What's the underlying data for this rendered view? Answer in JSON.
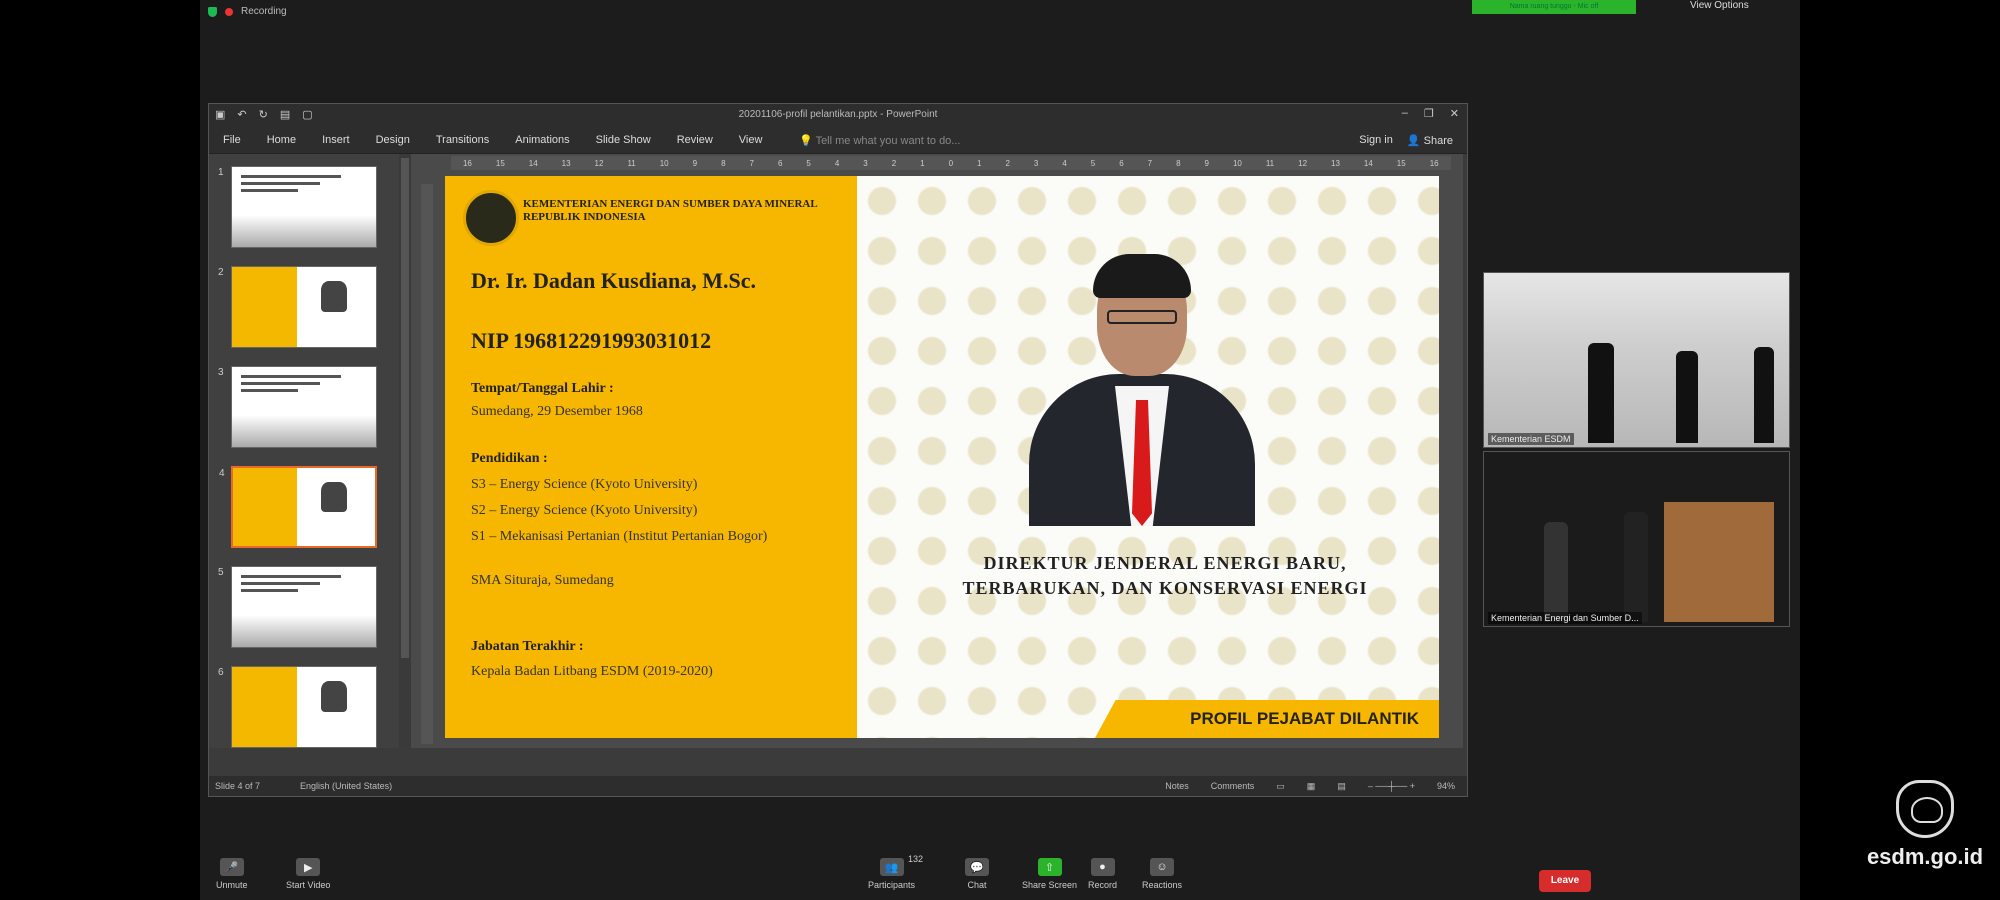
{
  "zoom": {
    "recording_label": "Recording",
    "banner_text": "Nama ruang tunggu - Mic off",
    "view_options": "View Options",
    "toolbar": {
      "unmute": "Unmute",
      "start_video": "Start Video",
      "participants": "Participants",
      "participants_count": "132",
      "chat": "Chat",
      "share_screen": "Share Screen",
      "record": "Record",
      "reactions": "Reactions",
      "leave": "Leave"
    },
    "videos": [
      {
        "name": "Kementerian ESDM"
      },
      {
        "name": "Kementerian Energi dan Sumber D..."
      }
    ]
  },
  "powerpoint": {
    "doc_title": "20201106-profil pelantikan.pptx - PowerPoint",
    "ribbon_tabs": [
      "File",
      "Home",
      "Insert",
      "Design",
      "Transitions",
      "Animations",
      "Slide Show",
      "Review",
      "View"
    ],
    "tell_me": "Tell me what you want to do...",
    "sign_in": "Sign in",
    "share": "Share",
    "thumbnails": [
      {
        "num": "1",
        "type": "white"
      },
      {
        "num": "2",
        "type": "yellow"
      },
      {
        "num": "3",
        "type": "white"
      },
      {
        "num": "4",
        "type": "yellow"
      },
      {
        "num": "5",
        "type": "white"
      },
      {
        "num": "6",
        "type": "yellow"
      }
    ],
    "ruler_ticks": [
      "16",
      "15",
      "14",
      "13",
      "12",
      "11",
      "10",
      "9",
      "8",
      "7",
      "6",
      "5",
      "4",
      "3",
      "2",
      "1",
      "0",
      "1",
      "2",
      "3",
      "4",
      "5",
      "6",
      "7",
      "8",
      "9",
      "10",
      "11",
      "12",
      "13",
      "14",
      "15",
      "16"
    ],
    "status": {
      "slide": "Slide 4 of 7",
      "language": "English (United States)",
      "notes": "Notes",
      "comments": "Comments",
      "zoom": "94%"
    }
  },
  "slide": {
    "ministry_line1": "KEMENTERIAN ENERGI DAN SUMBER DAYA MINERAL",
    "ministry_line2": "REPUBLIK INDONESIA",
    "name": "Dr. Ir. Dadan Kusdiana, M.Sc.",
    "nip": "NIP 196812291993031012",
    "birth_label": "Tempat/Tanggal Lahir :",
    "birth_value": "Sumedang, 29 Desember 1968",
    "education_label": "Pendidikan :",
    "education": [
      "S3 – Energy Science (Kyoto University)",
      "S2 – Energy Science (Kyoto University)",
      "S1 – Mekanisasi Pertanian (Institut Pertanian Bogor)",
      "SMA Situraja, Sumedang"
    ],
    "position_label": "Jabatan Terakhir :",
    "position_value": "Kepala Badan Litbang ESDM (2019-2020)",
    "role_title_line1": "DIREKTUR JENDERAL ENERGI BARU,",
    "role_title_line2": "TERBARUKAN, DAN KONSERVASI ENERGI",
    "banner": "PROFIL PEJABAT DILANTIK"
  },
  "watermark": "esdm.go.id",
  "colors": {
    "slide_yellow": "#f7b700",
    "leave_red": "#d62c2c",
    "zoom_green": "#2bb42b"
  }
}
